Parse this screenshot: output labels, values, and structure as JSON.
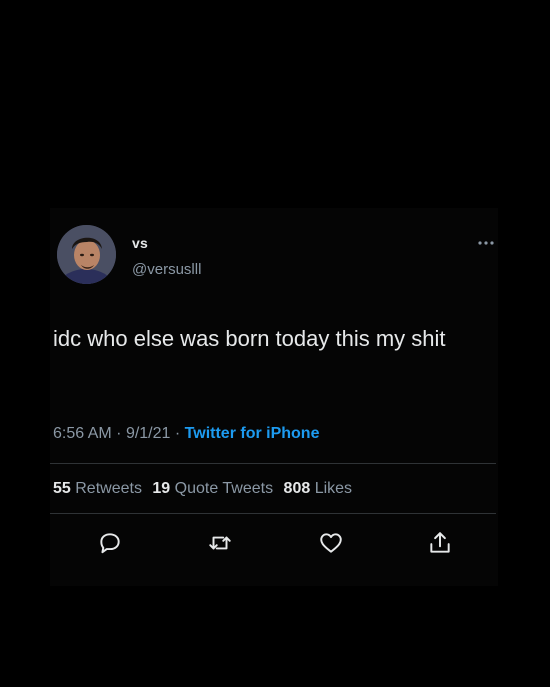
{
  "tweet": {
    "display_name": "vs",
    "handle": "@versuslll",
    "text": "idc who else was born today this my shit",
    "time": "6:56 AM",
    "date": "9/1/21",
    "separator": "·",
    "source": "Twitter for iPhone",
    "stats": {
      "retweets_count": "55",
      "retweets_label": "Retweets",
      "quotes_count": "19",
      "quotes_label": "Quote Tweets",
      "likes_count": "808",
      "likes_label": "Likes"
    }
  },
  "icons": {
    "more": "more-horizontal-icon",
    "reply": "reply-icon",
    "retweet": "retweet-icon",
    "like": "heart-icon",
    "share": "share-icon"
  },
  "colors": {
    "background": "#000000",
    "text": "#e7e9ea",
    "secondary": "#8b98a5",
    "accent": "#1d9bf0",
    "divider": "#2f3336"
  }
}
